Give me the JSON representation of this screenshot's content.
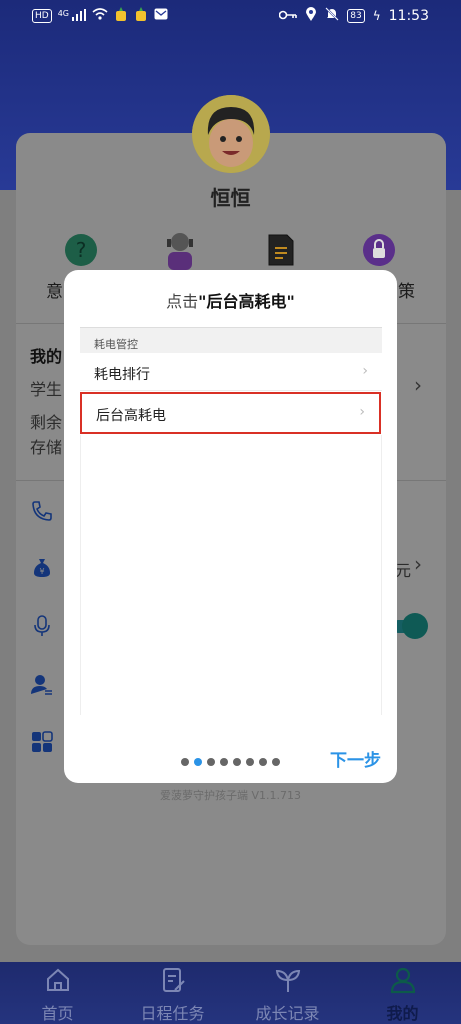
{
  "status_bar": {
    "hd_label": "HD",
    "signal_label": "4G",
    "battery": "83",
    "time": "11:53"
  },
  "profile": {
    "name": "恒恒",
    "quick_items": [
      {
        "label": "意",
        "icon": "question-icon"
      },
      {
        "label": "",
        "icon": "support-agent-icon"
      },
      {
        "label": "",
        "icon": "document-icon"
      },
      {
        "label": "策",
        "icon": "privacy-lock-icon"
      }
    ]
  },
  "background_list": {
    "section_title": "我的",
    "line1": "学生",
    "line2": "剩余",
    "line3": "存储",
    "amount_suffix": "元",
    "version": "爱菠萝守护孩子端 V1.1.713"
  },
  "modal": {
    "title_prefix": "点击",
    "title_highlight": "\"后台高耗电\"",
    "screenshot": {
      "section_header": "耗电管控",
      "rows": [
        {
          "label": "耗电排行"
        },
        {
          "label": "后台高耗电"
        }
      ]
    },
    "page_count": 8,
    "active_page": 2,
    "next_label": "下一步"
  },
  "tabbar": {
    "tabs": [
      {
        "label": "首页",
        "icon": "home-icon",
        "active": false
      },
      {
        "label": "日程任务",
        "icon": "task-edit-icon",
        "active": false
      },
      {
        "label": "成长记录",
        "icon": "sprout-icon",
        "active": false
      },
      {
        "label": "我的",
        "icon": "user-icon",
        "active": true
      }
    ]
  },
  "colors": {
    "accent": "#2b93e6",
    "highlight_border": "#d93025",
    "header": "#283a96"
  }
}
